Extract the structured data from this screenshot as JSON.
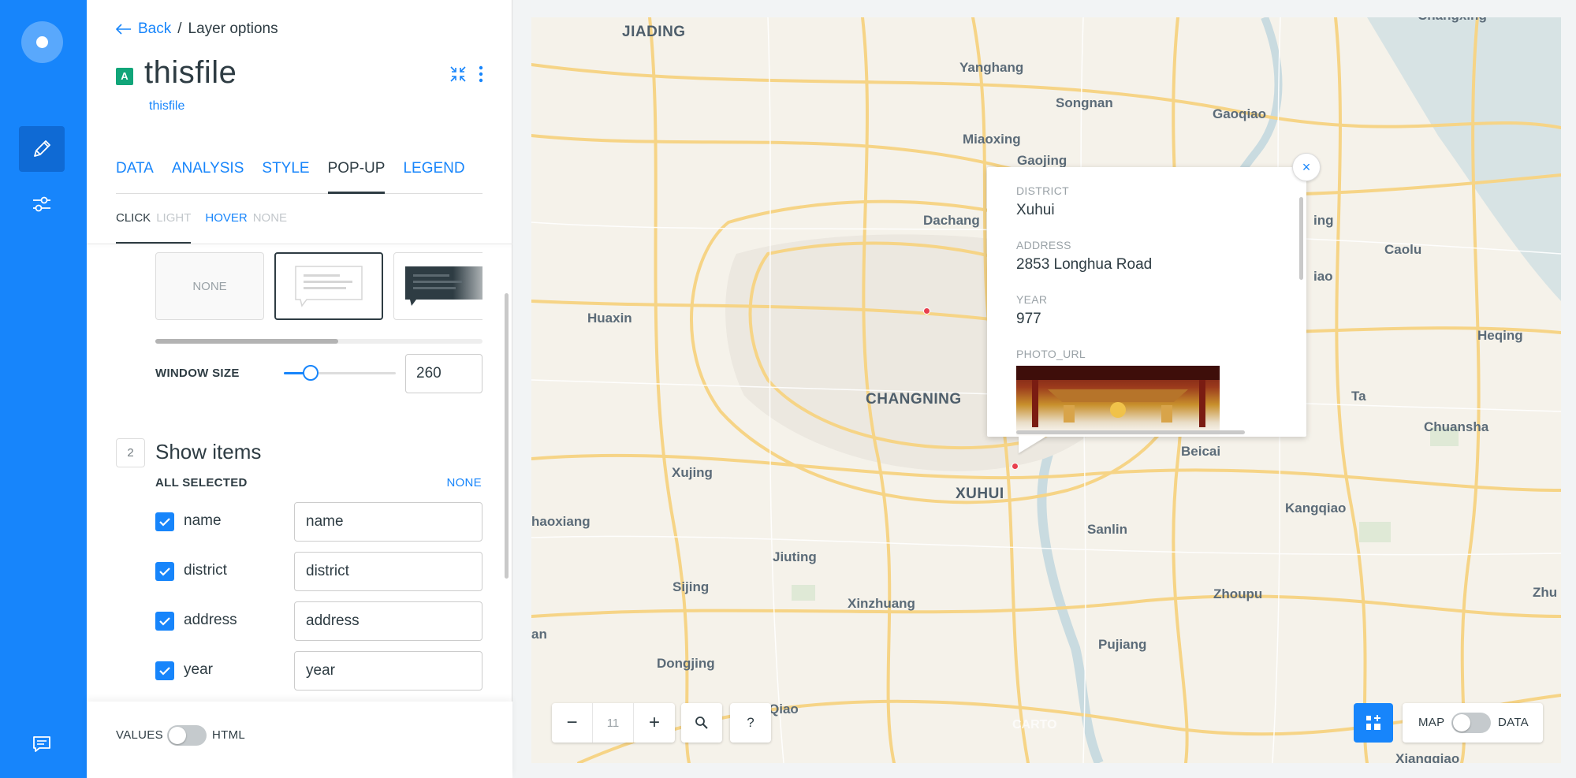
{
  "breadcrumb": {
    "back_label": "Back",
    "separator": "/",
    "current": "Layer options"
  },
  "layer": {
    "badge": "A",
    "title": "thisfile",
    "source": "thisfile"
  },
  "tabs": [
    {
      "label": "DATA",
      "active": false
    },
    {
      "label": "ANALYSIS",
      "active": false
    },
    {
      "label": "STYLE",
      "active": false
    },
    {
      "label": "POP-UP",
      "active": true
    },
    {
      "label": "LEGEND",
      "active": false
    }
  ],
  "subtabs": {
    "click": {
      "label": "CLICK",
      "value": "LIGHT"
    },
    "hover": {
      "label": "HOVER",
      "value": "NONE"
    }
  },
  "popup_styles": {
    "none_label": "NONE",
    "selected": "light"
  },
  "window_size": {
    "label": "WINDOW SIZE",
    "value": "260",
    "slider_fraction": 0.24
  },
  "show_items": {
    "number": "2",
    "title": "Show items",
    "all_selected": "ALL SELECTED",
    "none_link": "NONE",
    "items": [
      {
        "name": "name",
        "value": "name",
        "checked": true
      },
      {
        "name": "district",
        "value": "district",
        "checked": true
      },
      {
        "name": "address",
        "value": "address",
        "checked": true
      },
      {
        "name": "year",
        "value": "year",
        "checked": true
      }
    ]
  },
  "footer": {
    "values_label": "VALUES",
    "html_label": "HTML"
  },
  "map": {
    "labels": {
      "jiading": "JIADING",
      "yanghang": "Yanghang",
      "songnan": "Songnan",
      "gaoqiao": "Gaoqiao",
      "miaoxing": "Miaoxing",
      "gaojing": "Gaojing",
      "dachang": "Dachang",
      "caolu": "Caolu",
      "huaxin": "Huaxin",
      "heqing": "Heqing",
      "changning": "CHANGNING",
      "ta": "Ta",
      "chuansha": "Chuansha",
      "beicai": "Beicai",
      "xujing": "Xujing",
      "xuhui": "XUHUI",
      "haoxiang": "haoxiang",
      "kangqiao": "Kangqiao",
      "sanlin": "Sanlin",
      "jiuting": "Jiuting",
      "sijing": "Sijing",
      "zhoupu": "Zhoupu",
      "xinzhuang": "Xinzhuang",
      "zhu": "Zhu",
      "an": "an",
      "pujiang": "Pujiang",
      "dongjing": "Dongjing",
      "qiao": "Qiao",
      "xiangqiao": "Xiangqiao",
      "jiao": "iao",
      "ing": "ing",
      "changxing": "Changxing"
    },
    "popup": {
      "fields": [
        {
          "label": "DISTRICT",
          "value": "Xuhui"
        },
        {
          "label": "ADDRESS",
          "value": "2853 Longhua Road"
        },
        {
          "label": "YEAR",
          "value": "977"
        },
        {
          "label": "PHOTO_URL",
          "value": ""
        }
      ],
      "close_glyph": "×"
    },
    "zoom": {
      "minus": "−",
      "level": "11",
      "plus": "+"
    },
    "search_glyph": "⚲",
    "help_glyph": "?",
    "view_toggle": {
      "map_label": "MAP",
      "data_label": "DATA"
    },
    "attribution": "CARTO"
  },
  "colors": {
    "brand_blue": "#1785fb",
    "sidebar_blue": "#1785fb",
    "badge_green": "#11a579",
    "pin_red": "#e8404e"
  },
  "icons": {
    "rail": [
      "logo-icon",
      "pencil-icon",
      "sliders-icon",
      "chat-icon"
    ],
    "header": [
      "collapse-icon",
      "kebab-menu-icon"
    ]
  }
}
